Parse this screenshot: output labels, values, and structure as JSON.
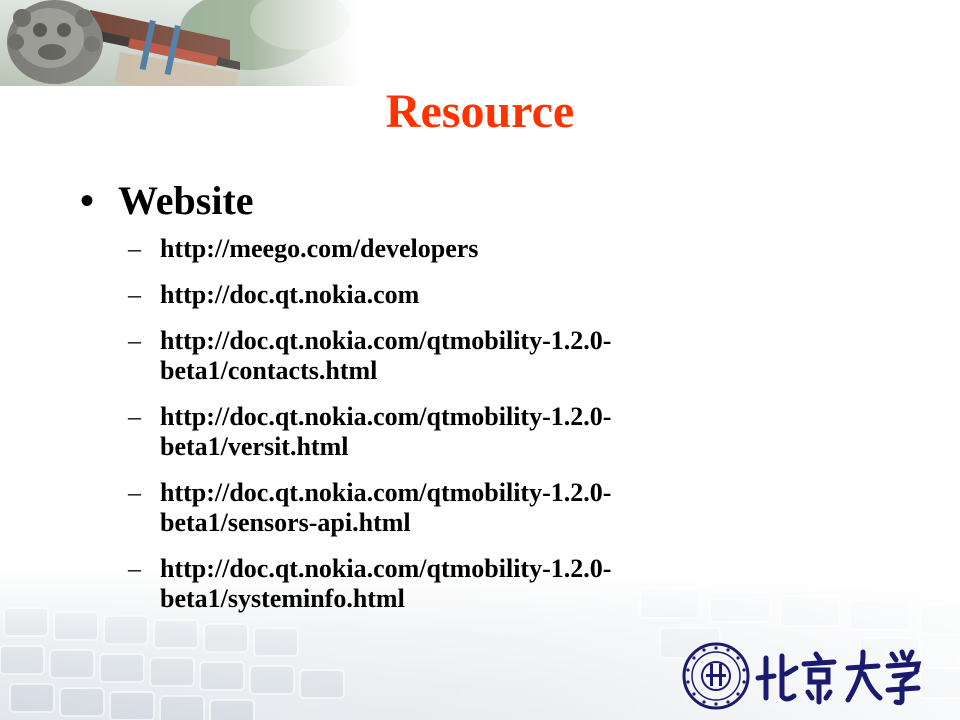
{
  "slide": {
    "title": "Resource",
    "bullet": "Website",
    "links": [
      {
        "text": "http://meego.com/developers"
      },
      {
        "text": "http://doc.qt.nokia.com"
      },
      {
        "text": "http://doc.qt.nokia.com/qtmobility-1.2.0-beta1/contacts.html"
      },
      {
        "text": "http://doc.qt.nokia.com/qtmobility-1.2.0-beta1/versit.html"
      },
      {
        "text": "http://doc.qt.nokia.com/qtmobility-1.2.0-beta1/sensors-api.html"
      },
      {
        "text": "http://doc.qt.nokia.com/qtmobility-1.2.0-beta1/systeminfo.html"
      }
    ]
  },
  "colors": {
    "title": "#ff3300",
    "text": "#000000",
    "logo": "#1a1a6e"
  },
  "icons": {
    "header": "stone-lion-photo",
    "footer": "keyboard-background",
    "logo": "peking-university-seal-icon"
  },
  "bullet_glyphs": {
    "level1": "•",
    "level2": "–"
  }
}
